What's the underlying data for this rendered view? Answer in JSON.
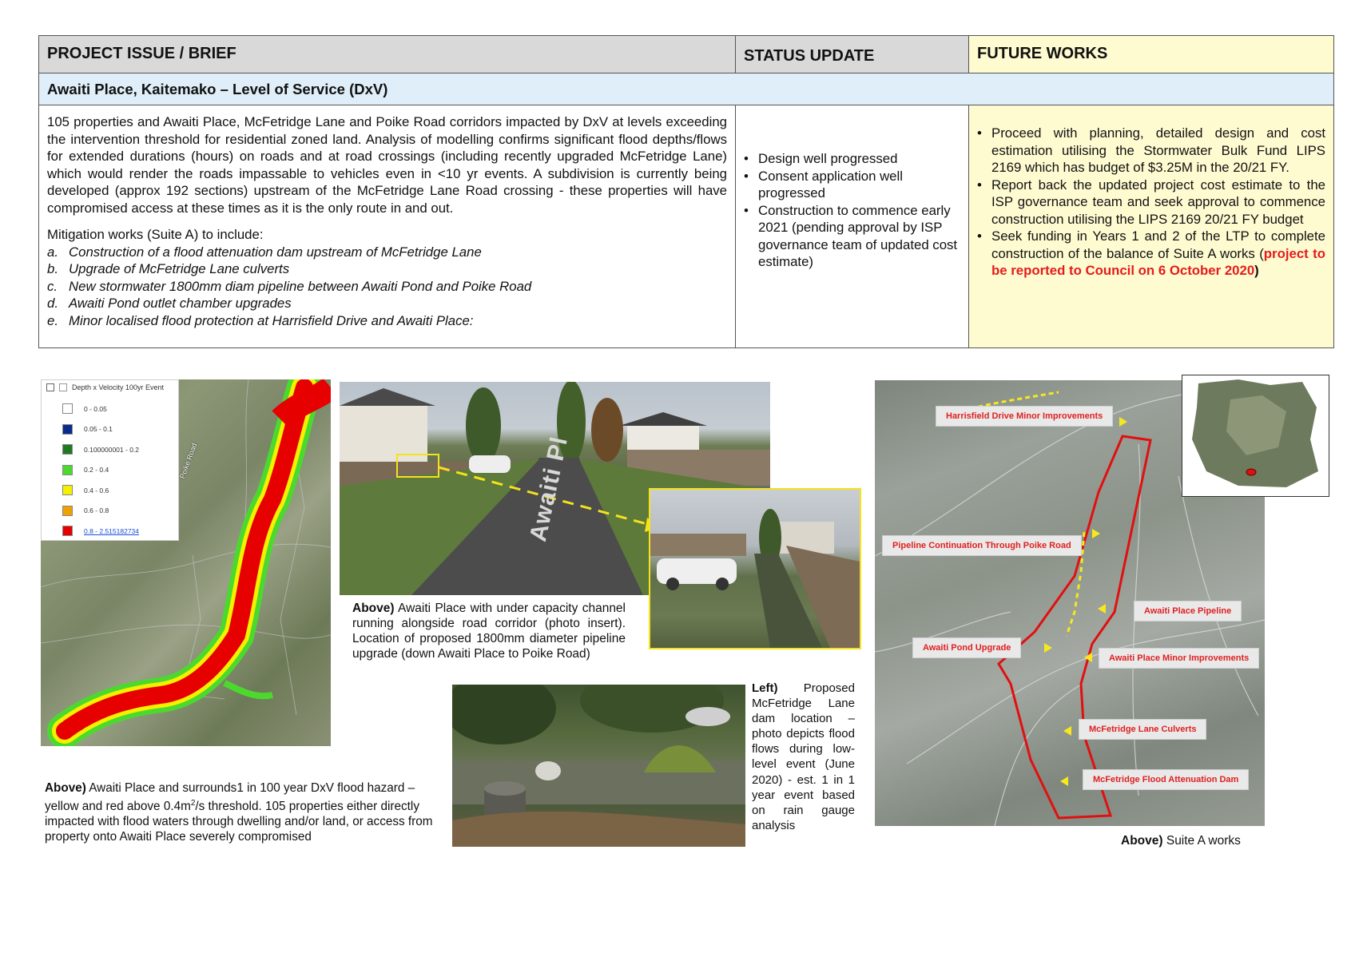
{
  "table": {
    "headers": {
      "issue": "PROJECT ISSUE / BRIEF",
      "status": "STATUS UPDATE",
      "future": "FUTURE WORKS"
    },
    "project_title": "Awaiti Place, Kaitemako  – Level of Service (DxV)",
    "issue_paragraph": "105 properties and Awaiti Place, McFetridge Lane and Poike Road corridors impacted by DxV at levels exceeding the intervention threshold for residential zoned land.  Analysis of modelling confirms significant flood depths/flows for extended durations (hours) on roads and at road crossings (including recently upgraded McFetridge Lane) which would render the roads impassable to vehicles even in <10 yr events.  A subdivision is currently being developed (approx 192 sections) upstream of the McFetridge Lane Road crossing - these properties will have compromised access at these times as it is the only route in and out.",
    "mitigation_intro": "Mitigation works (Suite A) to include:",
    "mitigation_items": [
      {
        "letter": "a.",
        "text": "Construction of a flood attenuation dam upstream of McFetridge Lane"
      },
      {
        "letter": "b.",
        "text": "Upgrade of McFetridge Lane culverts"
      },
      {
        "letter": "c.",
        "text": "New stormwater 1800mm diam pipeline between Awaiti Pond and Poike Road"
      },
      {
        "letter": "d.",
        "text": "Awaiti Pond outlet chamber upgrades"
      },
      {
        "letter": "e.",
        "text": "Minor localised flood protection at Harrisfield Drive and Awaiti Place:"
      }
    ],
    "status_items": [
      "Design well progressed",
      "Consent application well progressed",
      "Construction to commence early 2021 (pending approval by ISP governance team of updated cost estimate)"
    ],
    "future_items": [
      "Proceed with planning, detailed design and cost estimation utilising the Stormwater Bulk Fund LIPS 2169 which has budget of $3.25M in the 20/21 FY.",
      "Report back the updated project cost estimate to the ISP governance team and seek approval to commence construction utilising the LIPS 2169 20/21 FY budget"
    ],
    "future_last_prefix": "Seek funding in Years 1 and 2 of the LTP to complete construction of the balance of Suite A works (",
    "future_last_red": "project to be reported to Council on 6 October 2020",
    "future_last_suffix": ")"
  },
  "legend": {
    "title": "Depth x Velocity 100yr Event",
    "items": [
      {
        "label": "0 - 0.05",
        "color": "#ffffff"
      },
      {
        "label": "0.05 - 0.1",
        "color": "#0b2a8c"
      },
      {
        "label": "0.100000001 - 0.2",
        "color": "#1f7a1f"
      },
      {
        "label": "0.2 - 0.4",
        "color": "#4cd92e"
      },
      {
        "label": "0.4 - 0.6",
        "color": "#f5f000"
      },
      {
        "label": "0.6 - 0.8",
        "color": "#f0a000"
      },
      {
        "label": "0.8 - 2.515182734",
        "color": "#e60000"
      }
    ]
  },
  "map1_streets": [
    "Poike Road"
  ],
  "photo1_sign": "Awaiti Pl",
  "captions": {
    "photo1_bold": "Above)",
    "photo1_text": " Awaiti Place with under capacity channel running alongside road corridor (photo insert). Location of proposed 1800mm diameter pipeline upgrade (down Awaiti Place to Poike Road)",
    "left_bold": "Left)",
    "left_text": " Proposed McFetridge Lane dam location – photo depicts flood flows during low-level event (June 2020) - est. 1 in 1 year event based on rain gauge analysis",
    "map1_bold": "Above)",
    "map1_text_a": " Awaiti Place and surrounds1 in 100 year DxV flood hazard – yellow and red above 0.4m",
    "map1_sup": "2",
    "map1_text_b": "/s threshold.  105 properties either directly impacted with flood waters through dwelling and/or land, or access from property onto Awaiti Place severely compromised",
    "suite_bold": "Above)",
    "suite_text": " Suite A works"
  },
  "map2_labels": [
    "Harrisfield Drive Minor Improvements",
    "Pipeline Continuation Through Poike Road",
    "Awaiti Place Pipeline",
    "Awaiti Pond Upgrade",
    "Awaiti Place Minor Improvements",
    "McFetridge Lane Culverts",
    "McFetridge Flood Attenuation Dam"
  ],
  "colors": {
    "header_grey": "#d9d9d9",
    "project_row_blue": "#dfeef8",
    "future_yellow": "#fffbd1",
    "highlight_red": "#e41c1c",
    "route_red": "#e01010",
    "insert_yellow": "#f4e21b"
  }
}
